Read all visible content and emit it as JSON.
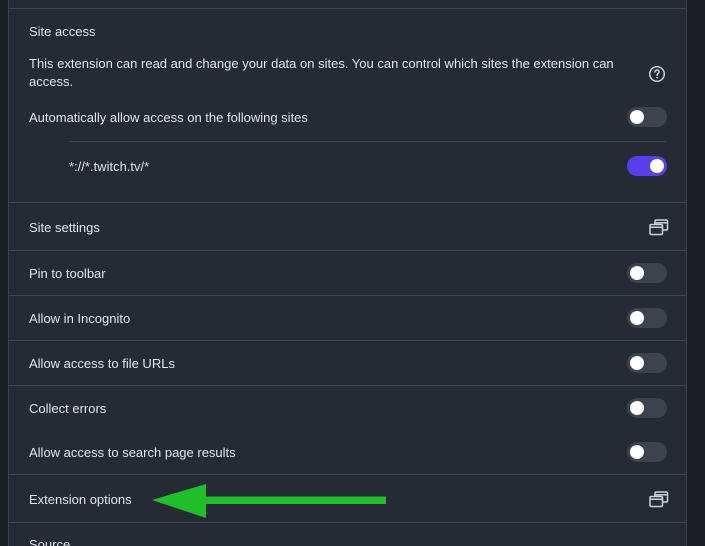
{
  "site_access": {
    "heading": "Site access",
    "description": "This extension can read and change your data on sites. You can control which sites the extension can access.",
    "auto_allow_label": "Automatically allow access on the following sites",
    "auto_allow_on": false,
    "site_pattern": "*://*.twitch.tv/*",
    "site_pattern_on": true
  },
  "rows": {
    "site_settings": "Site settings",
    "pin_to_toolbar": "Pin to toolbar",
    "allow_incognito": "Allow in Incognito",
    "allow_file_urls": "Allow access to file URLs",
    "collect_errors": "Collect errors",
    "allow_search_results": "Allow access to search page results",
    "extension_options": "Extension options",
    "source": "Source"
  },
  "colors": {
    "toggle_on": "#5b3df0",
    "toggle_off": "#3d434d",
    "arrow": "#1fbf2a"
  },
  "icons": {
    "help": "help-circle-icon",
    "open_external": "open-in-new-window-icon",
    "annotation": "green-arrow-pointing-left"
  }
}
